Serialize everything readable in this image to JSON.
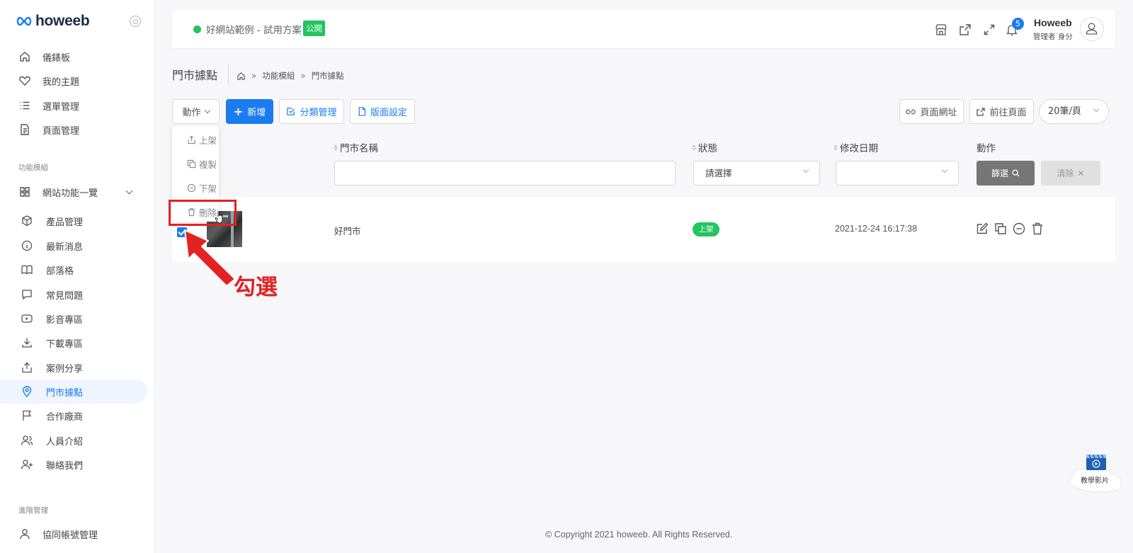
{
  "brand": {
    "name": "howeeb"
  },
  "sidebar": {
    "items": [
      {
        "label": "儀錶板",
        "icon": "home-icon"
      },
      {
        "label": "我的主題",
        "icon": "heart-icon"
      },
      {
        "label": "選單管理",
        "icon": "list-icon"
      },
      {
        "label": "頁面管理",
        "icon": "file-icon"
      }
    ],
    "section_modules": "功能模組",
    "group_label": "網站功能一覽",
    "modules": [
      {
        "label": "產品管理",
        "icon": "box-icon"
      },
      {
        "label": "最新消息",
        "icon": "info-icon"
      },
      {
        "label": "部落格",
        "icon": "book-icon"
      },
      {
        "label": "常見問題",
        "icon": "chat-icon"
      },
      {
        "label": "影音專區",
        "icon": "youtube-icon"
      },
      {
        "label": "下載專區",
        "icon": "download-icon"
      },
      {
        "label": "案例分享",
        "icon": "share-icon"
      },
      {
        "label": "門市據點",
        "icon": "map-pin-icon",
        "active": true
      },
      {
        "label": "合作廠商",
        "icon": "flag-icon"
      },
      {
        "label": "人員介紹",
        "icon": "users-icon"
      },
      {
        "label": "聯絡我們",
        "icon": "user-plus-icon"
      }
    ],
    "section_advanced": "進階管理",
    "advanced": [
      {
        "label": "協同帳號管理",
        "icon": "user-icon"
      }
    ]
  },
  "header": {
    "site_name": "好網站範例 - 試用方案",
    "public_badge": "公開",
    "notification_count": "5",
    "user_name": "Howeeb",
    "user_role": "管理者 身分"
  },
  "page": {
    "title": "門市據點",
    "breadcrumb": [
      "功能模組",
      "門市據點"
    ]
  },
  "toolbar": {
    "action_label": "動作",
    "add_label": "新增",
    "category_label": "分類管理",
    "layout_label": "版面設定",
    "page_url_label": "頁面網址",
    "goto_page_label": "前往頁面",
    "per_page": "20筆/頁"
  },
  "action_menu": {
    "publish": "上架",
    "copy": "複製",
    "unpublish": "下架",
    "delete": "刪除"
  },
  "table": {
    "headers": {
      "name": "門市名稱",
      "status": "狀態",
      "modified": "修改日期",
      "actions": "動作"
    },
    "filters": {
      "status_placeholder": "請選擇",
      "filter_button": "篩選",
      "clear_button": "清除"
    },
    "rows": [
      {
        "name": "好門市",
        "status": "上架",
        "modified": "2021-12-24 16:17:38",
        "checked": true
      }
    ]
  },
  "annotation": {
    "text": "勾選"
  },
  "footer": {
    "copyright": "© Copyright 2021 howeeb. All Rights Reserved."
  },
  "tutorial": {
    "label": "教學影片"
  },
  "colors": {
    "primary": "#1a7cf0",
    "success": "#22c55e",
    "annotation": "#e32222"
  }
}
